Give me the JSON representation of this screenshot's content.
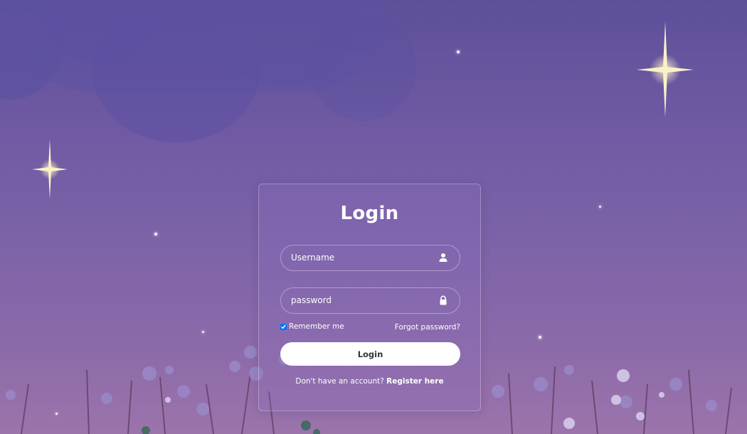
{
  "login_form": {
    "title": "Login",
    "username": {
      "placeholder": "Username",
      "icon": "user-icon"
    },
    "password": {
      "placeholder": "password",
      "icon": "lock-icon"
    },
    "remember_me": {
      "label": "Remember me",
      "checked": true
    },
    "forgot_password_label": "Forgot password?",
    "submit_label": "Login",
    "register_prompt": "Don't have an account?",
    "register_link_label": "Register here"
  },
  "colors": {
    "background_top": "#5e4f9a",
    "background_bottom": "#9b74aa",
    "button": "#ffffff",
    "button_text": "#333333",
    "text": "#ffffff"
  }
}
